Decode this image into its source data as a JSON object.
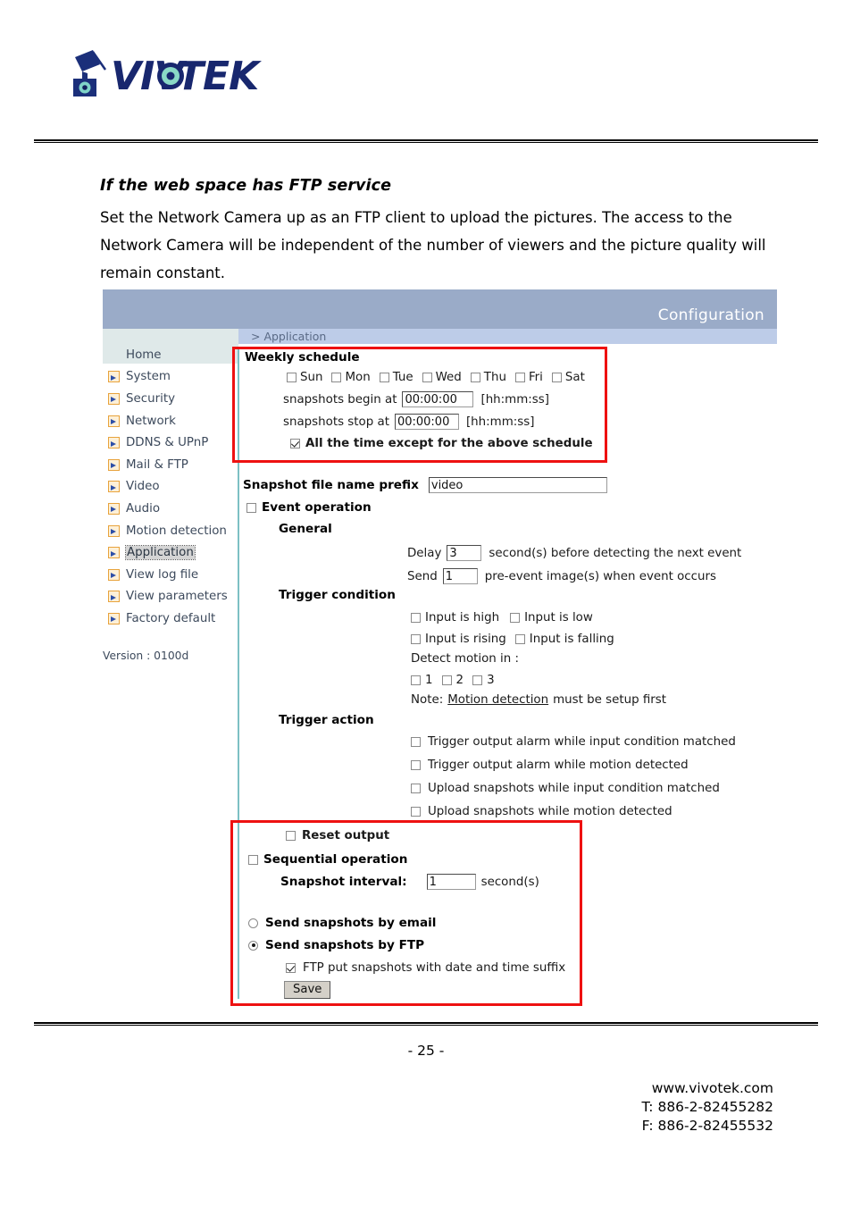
{
  "brand": {
    "name": "VIVOTEK",
    "logo_icon": "vivotek-camera-logo"
  },
  "document": {
    "heading": "If the web space has FTP service",
    "paragraph": "Set the Network Camera up as an FTP client to upload the pictures. The access to the Network Camera will be independent of the number of viewers and the picture quality will remain constant.",
    "page_number": "- 25 -",
    "footer": {
      "website": "www.vivotek.com",
      "tel": "T: 886-2-82455282",
      "fax": "F: 886-2-82455532"
    }
  },
  "config_panel": {
    "title": "Configuration",
    "breadcrumb": "> Application",
    "title_bar_color": "#9aabc8",
    "sub_bar_color": "#bdcce8",
    "sidebar_color": "#dfe9e9",
    "divider_color": "#7dc0c4",
    "annotation_color": "#ee1111"
  },
  "sidebar": {
    "items": [
      {
        "label": "Home",
        "icon": "none",
        "active": false
      },
      {
        "label": "System",
        "icon": "arrow-right-icon",
        "active": false
      },
      {
        "label": "Security",
        "icon": "arrow-right-icon",
        "active": false
      },
      {
        "label": "Network",
        "icon": "arrow-right-icon",
        "active": false
      },
      {
        "label": "DDNS & UPnP",
        "icon": "arrow-right-icon",
        "active": false
      },
      {
        "label": "Mail & FTP",
        "icon": "arrow-right-icon",
        "active": false
      },
      {
        "label": "Video",
        "icon": "arrow-right-icon",
        "active": false
      },
      {
        "label": "Audio",
        "icon": "arrow-right-icon",
        "active": false
      },
      {
        "label": "Motion detection",
        "icon": "arrow-right-icon",
        "active": false
      },
      {
        "label": "Application",
        "icon": "arrow-right-icon",
        "active": true
      },
      {
        "label": "View log file",
        "icon": "arrow-right-icon",
        "active": false
      },
      {
        "label": "View parameters",
        "icon": "arrow-right-icon",
        "active": false
      },
      {
        "label": "Factory default",
        "icon": "arrow-right-icon",
        "active": false
      }
    ],
    "version": "Version : 0100d"
  },
  "form": {
    "weekly_schedule": {
      "title": "Weekly schedule",
      "days": [
        {
          "label": "Sun",
          "checked": false
        },
        {
          "label": "Mon",
          "checked": false
        },
        {
          "label": "Tue",
          "checked": false
        },
        {
          "label": "Wed",
          "checked": false
        },
        {
          "label": "Thu",
          "checked": false
        },
        {
          "label": "Fri",
          "checked": false
        },
        {
          "label": "Sat",
          "checked": false
        }
      ],
      "begin_label": "snapshots begin at",
      "begin_value": "00:00:00",
      "begin_hint": "[hh:mm:ss]",
      "stop_label": "snapshots stop at",
      "stop_value": "00:00:00",
      "stop_hint": "[hh:mm:ss]",
      "all_time_label": "All the time except for the above schedule",
      "all_time_checked": true
    },
    "snapshot_prefix": {
      "label": "Snapshot file name prefix",
      "value": "video"
    },
    "event_operation": {
      "label": "Event operation",
      "checked": false,
      "general_label": "General",
      "delay_prefix": "Delay",
      "delay_value": "3",
      "delay_suffix": "second(s) before detecting the next event",
      "send_prefix": "Send",
      "send_value": "1",
      "send_suffix": "pre-event image(s) when event occurs"
    },
    "trigger_condition": {
      "title": "Trigger condition",
      "options_row1": [
        {
          "label": "Input is high",
          "checked": false
        },
        {
          "label": "Input is low",
          "checked": false
        }
      ],
      "options_row2": [
        {
          "label": "Input is rising",
          "checked": false
        },
        {
          "label": "Input is falling",
          "checked": false
        }
      ],
      "detect_motion_label": "Detect motion in :",
      "motion_zones": [
        {
          "label": "1",
          "checked": false
        },
        {
          "label": "2",
          "checked": false
        },
        {
          "label": "3",
          "checked": false
        }
      ],
      "note_prefix": "Note:",
      "note_link": "Motion detection",
      "note_suffix": "must be setup first"
    },
    "trigger_action": {
      "title": "Trigger action",
      "options": [
        {
          "label": "Trigger output alarm while input condition matched",
          "checked": false
        },
        {
          "label": "Trigger output alarm while motion detected",
          "checked": false
        },
        {
          "label": "Upload snapshots while input condition matched",
          "checked": false
        },
        {
          "label": "Upload snapshots while motion detected",
          "checked": false
        }
      ],
      "reset_output_label": "Reset output",
      "reset_output_checked": false
    },
    "sequential_operation": {
      "label": "Sequential operation",
      "checked": false,
      "interval_label": "Snapshot interval:",
      "interval_value": "1",
      "interval_suffix": "second(s)"
    },
    "delivery": {
      "email_label": "Send snapshots by email",
      "email_selected": false,
      "ftp_label": "Send snapshots by FTP",
      "ftp_selected": true,
      "ftp_suffix_label": "FTP put snapshots with date and time suffix",
      "ftp_suffix_checked": true
    },
    "save_label": "Save"
  }
}
